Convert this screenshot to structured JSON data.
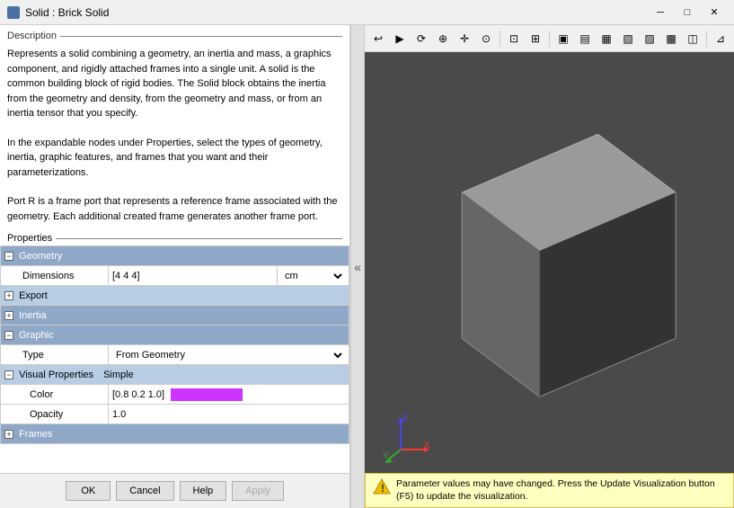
{
  "window": {
    "title": "Solid : Brick Solid",
    "minimize_label": "─",
    "maximize_label": "□",
    "close_label": "✕"
  },
  "description": {
    "heading": "Description",
    "paragraphs": [
      "Represents a solid combining a geometry, an inertia and mass, a graphics component, and rigidly attached frames into a single unit. A solid is the common building block of rigid bodies. The Solid block obtains the inertia from the geometry and density, from the geometry and mass, or from an inertia tensor that you specify.",
      "In the expandable nodes under Properties, select the types of geometry, inertia, graphic features, and frames that you want and their parameterizations.",
      "Port R is a frame port that represents a reference frame associated with the geometry. Each additional created frame generates another frame port."
    ]
  },
  "properties": {
    "heading": "Properties",
    "sections": [
      {
        "name": "Geometry",
        "expanded": true,
        "rows": [
          {
            "name": "Dimensions",
            "value": "[4 4 4]",
            "unit": "cm",
            "type": "input"
          }
        ],
        "subsections": [
          {
            "name": "Export",
            "expanded": false,
            "rows": []
          }
        ]
      },
      {
        "name": "Inertia",
        "expanded": false,
        "rows": []
      },
      {
        "name": "Graphic",
        "expanded": true,
        "rows": [
          {
            "name": "Type",
            "value": "From Geometry",
            "unit": "",
            "type": "select"
          }
        ],
        "subsections": [
          {
            "name": "Visual Properties",
            "label": "Simple",
            "expanded": true,
            "rows": [
              {
                "name": "Color",
                "value": "[0.8 0.2 1.0]",
                "unit": "",
                "type": "color",
                "color": "#cc33ff"
              },
              {
                "name": "Opacity",
                "value": "1.0",
                "unit": "",
                "type": "text"
              }
            ]
          }
        ]
      },
      {
        "name": "Frames",
        "expanded": false,
        "rows": []
      }
    ]
  },
  "buttons": {
    "ok": "OK",
    "cancel": "Cancel",
    "help": "Help",
    "apply": "Apply"
  },
  "notification": {
    "text": "Parameter values may have changed. Press the Update Visualization button (F5) to update the visualization."
  },
  "toolbar": {
    "icons": [
      "↩",
      "↪",
      "⊕",
      "↕",
      "◎",
      "⊞",
      "⊟",
      "▣",
      "◩",
      "◪",
      "◫",
      "◬",
      "◭",
      "◮",
      "⊾"
    ]
  }
}
